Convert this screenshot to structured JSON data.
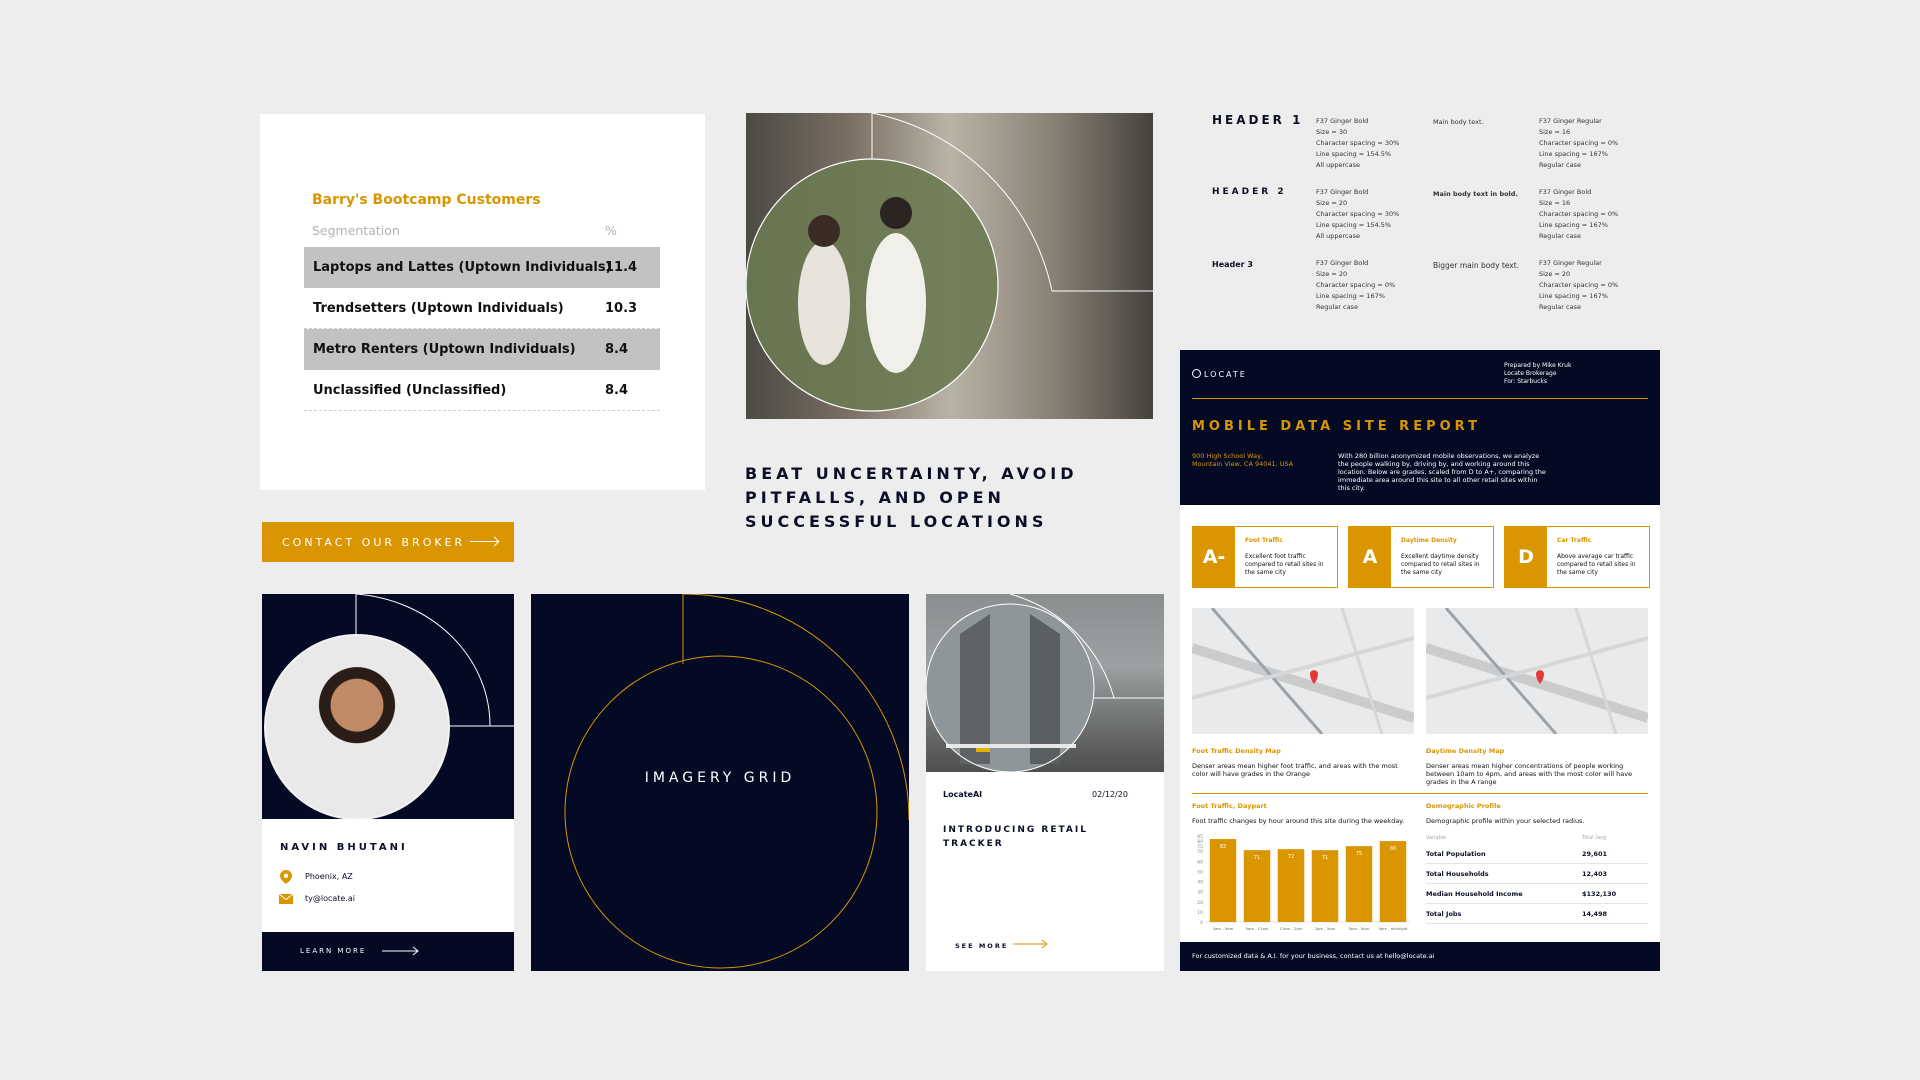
{
  "segmentation": {
    "title": "Barry's Bootcamp Customers",
    "col1": "Segmentation",
    "col2": "%",
    "rows": [
      {
        "label": "Laptops and Lattes (Uptown Individuals)",
        "value": "11.4"
      },
      {
        "label": "Trendsetters (Uptown Individuals)",
        "value": "10.3"
      },
      {
        "label": "Metro Renters (Uptown Individuals)",
        "value": "8.4"
      },
      {
        "label": "Unclassified (Unclassified)",
        "value": "8.4"
      }
    ]
  },
  "contact_button": "CONTACT OUR BROKER",
  "tagline": "BEAT UNCERTAINTY, AVOID PITFALLS, AND OPEN SUCCESSFUL LOCATIONS",
  "typography": [
    {
      "name": "HEADER 1",
      "spec": "F37 Ginger Bold\nSize = 30\nCharacter spacing = 30%\nLine spacing = 154.5%\nAll uppercase",
      "body_name": "Main body text.",
      "body_spec": "F37 Ginger Regular\nSize = 16\nCharacter spacing = 0%\nLine spacing = 167%\nRegular case"
    },
    {
      "name": "HEADER 2",
      "spec": "F37 Ginger Bold\nSize = 20\nCharacter spacing = 30%\nLine spacing = 154.5%\nAll uppercase",
      "body_name": "Main body text in bold.",
      "body_spec": "F37 Ginger Bold\nSize = 16\nCharacter spacing = 0%\nLine spacing = 167%\nRegular case"
    },
    {
      "name": "Header 3",
      "spec": "F37 Ginger Bold\nSize = 20\nCharacter spacing = 0%\nLine spacing = 167%\nRegular case",
      "body_name": "Bigger main body text.",
      "body_spec": "F37 Ginger Regular\nSize = 20\nCharacter spacing = 0%\nLine spacing = 167%\nRegular case"
    }
  ],
  "profile": {
    "name": "NAVIN BHUTANI",
    "location": "Phoenix, AZ",
    "email": "ty@locate.ai",
    "cta": "LEARN MORE"
  },
  "imagery_grid": "IMAGERY GRID",
  "blog": {
    "brand": "LocateAI",
    "date": "02/12/20",
    "title": "INTRODUCING RETAIL TRACKER",
    "cta": "SEE MORE"
  },
  "report": {
    "logo": "LOCATE",
    "prepared": "Prepared by Mike Kruk\nLocate Brokerage\nFor: Starbucks",
    "title": "MOBILE DATA SITE REPORT",
    "address": "900 High School Way,\nMountain View, CA 94041, USA",
    "description": "With 280 billion anonymized mobile observations, we analyze the people walking by, driving by, and working around this location. Below are grades, scaled from D to A+, comparing the immediate area around this site to all other retail sites within this city.",
    "grades": [
      {
        "grade": "A-",
        "title": "Foot Traffic",
        "desc": "Excellent foot traffic compared to retail sites in the same city"
      },
      {
        "grade": "A",
        "title": "Daytime Density",
        "desc": "Excellent daytime density compared to retail sites in the same city"
      },
      {
        "grade": "D",
        "title": "Car Traffic",
        "desc": "Above average car traffic compared to retail sites in the same city"
      }
    ],
    "maps": [
      {
        "title": "Foot Traffic Density Map",
        "desc": "Denser areas mean higher foot traffic, and areas with the most color will have grades in the Orange"
      },
      {
        "title": "Daytime Density Map",
        "desc": "Denser areas mean higher concentrations of people working between 10am to 4pm, and areas with the most color will have grades in the A range"
      }
    ],
    "daypart": {
      "title": "Foot Traffic, Daypart",
      "desc": "Foot traffic changes by hour around this site during the weekday."
    },
    "demographic": {
      "title": "Demographic Profile",
      "desc": "Demographic profile within your selected radius.",
      "col1": "Variable",
      "col2": "Total /avg",
      "rows": [
        {
          "label": "Total Population",
          "value": "29,601"
        },
        {
          "label": "Total Households",
          "value": "12,403"
        },
        {
          "label": "Median Household Income",
          "value": "$132,130"
        },
        {
          "label": "Total Jobs",
          "value": "14,498"
        }
      ]
    },
    "footer": "For customized data & A.I. for your business, contact us at hello@locate.ai"
  },
  "chart_data": {
    "type": "bar",
    "categories": [
      "4am - 9am",
      "9am - 11am",
      "11am - 2pm",
      "2pm - 5pm",
      "5pm - 9pm",
      "9pm - midnight"
    ],
    "values": [
      82,
      71,
      72,
      71,
      75,
      80
    ],
    "ylim": [
      0,
      85
    ],
    "yticks": [
      0,
      10,
      20,
      30,
      40,
      50,
      60,
      70,
      75,
      80,
      85
    ],
    "color": "#d99600"
  },
  "colors": {
    "navy": "#050a24",
    "gold": "#d99600",
    "background": "#ededed"
  }
}
